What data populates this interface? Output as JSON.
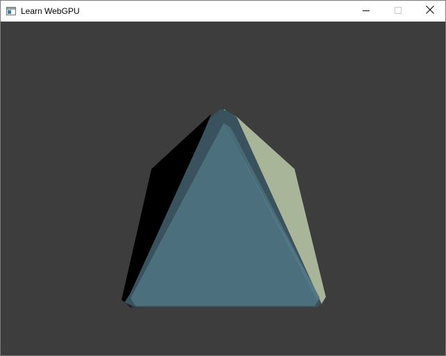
{
  "window": {
    "title": "Learn WebGPU",
    "icon": "app-window-icon"
  },
  "controls": {
    "minimize_icon": "minimize-icon",
    "maximize_icon": "maximize-icon",
    "close_icon": "close-icon"
  },
  "scene": {
    "background_color": "#3d3d3d",
    "object": "pyramid",
    "colors": {
      "front_face": "#4c6f7d",
      "right_face": "#a9b598",
      "left_face": "#000000",
      "edge_band": "#39525d"
    }
  }
}
